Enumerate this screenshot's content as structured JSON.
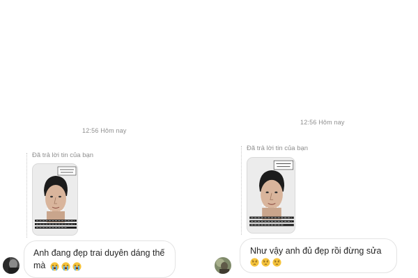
{
  "left": {
    "timestamp": "12:56 Hôm nay",
    "reply_note": "Đã trả lời tin của bạn",
    "message": "Anh đang đẹp trai duyên dáng thế mà",
    "emojis": [
      "loudly-crying-face",
      "loudly-crying-face",
      "loudly-crying-face"
    ]
  },
  "right": {
    "timestamp": "12:56 Hôm nay",
    "reply_note": "Đã trả lời tin của bạn",
    "message": "Như vậy anh đủ đẹp rồi đừng sửa",
    "emojis": [
      "pensive-face",
      "pensive-face",
      "pensive-face"
    ]
  },
  "colors": {
    "meta_text": "#8e8e8e",
    "bubble_border": "#e3e3e3",
    "message_text": "#262626"
  }
}
